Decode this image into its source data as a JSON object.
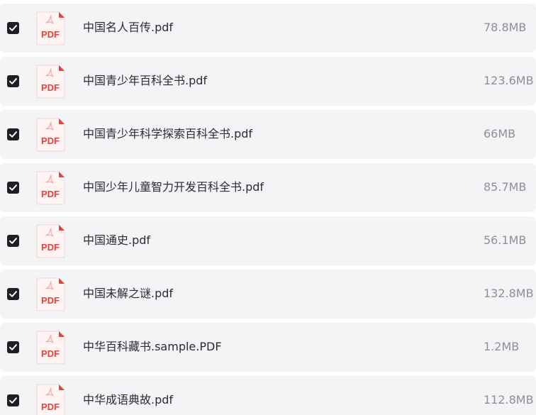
{
  "icons": {
    "checkbox": "check-icon",
    "file": "pdf-file-icon"
  },
  "colors": {
    "row_background": "#f4f4f6",
    "checkbox_fill": "#1f1f23",
    "pdf_red": "#e2443b",
    "name_text": "#2a2c33",
    "size_text": "#8d8f96"
  },
  "files": [
    {
      "name": "中国名人百传.pdf",
      "size": "78.8MB",
      "checked": true,
      "icon_label": "PDF"
    },
    {
      "name": "中国青少年百科全书.pdf",
      "size": "123.6MB",
      "checked": true,
      "icon_label": "PDF"
    },
    {
      "name": "中国青少年科学探索百科全书.pdf",
      "size": "66MB",
      "checked": true,
      "icon_label": "PDF"
    },
    {
      "name": "中国少年儿童智力开发百科全书.pdf",
      "size": "85.7MB",
      "checked": true,
      "icon_label": "PDF"
    },
    {
      "name": "中国通史.pdf",
      "size": "56.1MB",
      "checked": true,
      "icon_label": "PDF"
    },
    {
      "name": "中国未解之谜.pdf",
      "size": "132.8MB",
      "checked": true,
      "icon_label": "PDF"
    },
    {
      "name": "中华百科藏书.sample.PDF",
      "size": "1.2MB",
      "checked": true,
      "icon_label": "PDF"
    },
    {
      "name": "中华成语典故.pdf",
      "size": "112.8MB",
      "checked": true,
      "icon_label": "PDF"
    }
  ]
}
